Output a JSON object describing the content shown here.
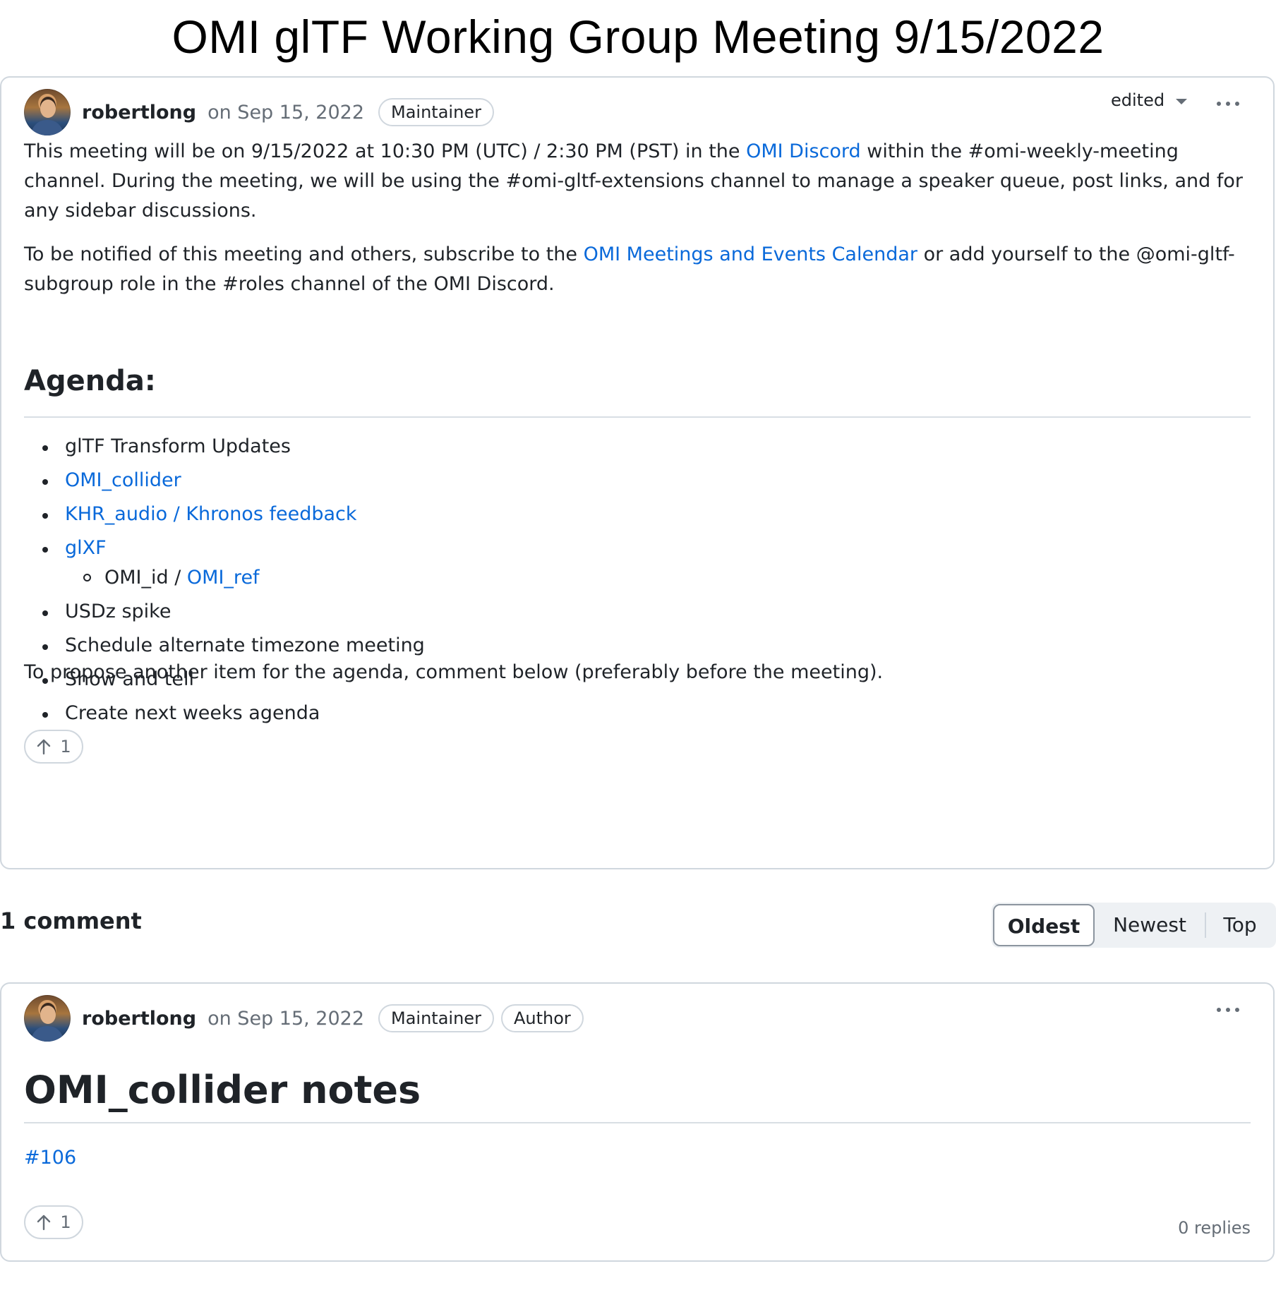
{
  "page": {
    "title": "OMI glTF Working Group Meeting 9/15/2022"
  },
  "post": {
    "author": "robertlong",
    "date": "on Sep 15, 2022",
    "labels": [
      "Maintainer"
    ],
    "edited_label": "edited",
    "intro": {
      "part1": "This meeting will be on 9/15/2022 at 10:30 PM (UTC) / 2:30 PM (PST) in the ",
      "link1": "OMI Discord",
      "part2": " within the #omi-weekly-meeting channel. During the meeting, we will be using the #omi-gltf-extensions channel to manage a speaker queue, post links, and for any sidebar discussions."
    },
    "notify": {
      "part1": "To be notified of this meeting and others, subscribe to the ",
      "link1": "OMI Meetings and Events Calendar",
      "part2": " or add yourself to the @omi-gltf-subgroup role in the #roles channel of the OMI Discord."
    },
    "agenda_heading": "Agenda:",
    "agenda": [
      {
        "text": "glTF Transform Updates",
        "link": false
      },
      {
        "text": "OMI_collider",
        "link": true
      },
      {
        "text": "KHR_audio / Khronos feedback",
        "link": true
      },
      {
        "text": "glXF",
        "link": true
      },
      {
        "text": "USDz spike",
        "link": false
      },
      {
        "text": "Schedule alternate timezone meeting",
        "link": false
      },
      {
        "text": "Show and tell",
        "link": false
      },
      {
        "text": "Create next weeks agenda",
        "link": false
      }
    ],
    "agenda_sub": {
      "plain": "OMI_id / ",
      "link": "OMI_ref"
    },
    "footer": "To propose another item for the agenda, comment below (preferably before the meeting).",
    "upvotes": "1"
  },
  "comments": {
    "count_label": "1 comment",
    "sort_options": [
      "Oldest",
      "Newest",
      "Top"
    ],
    "sort_selected": "Oldest",
    "items": [
      {
        "author": "robertlong",
        "date": "on Sep 15, 2022",
        "labels": [
          "Maintainer",
          "Author"
        ],
        "title": "OMI_collider notes",
        "link": "#106",
        "upvotes": "1",
        "replies": "0 replies"
      }
    ]
  },
  "icons": {
    "upvote": "arrow-up-icon",
    "menu": "kebab-horizontal-icon",
    "dropdown": "triangle-down-icon"
  },
  "colors": {
    "link": "#0969da",
    "border": "#d0d7de",
    "muted": "#656d76"
  }
}
